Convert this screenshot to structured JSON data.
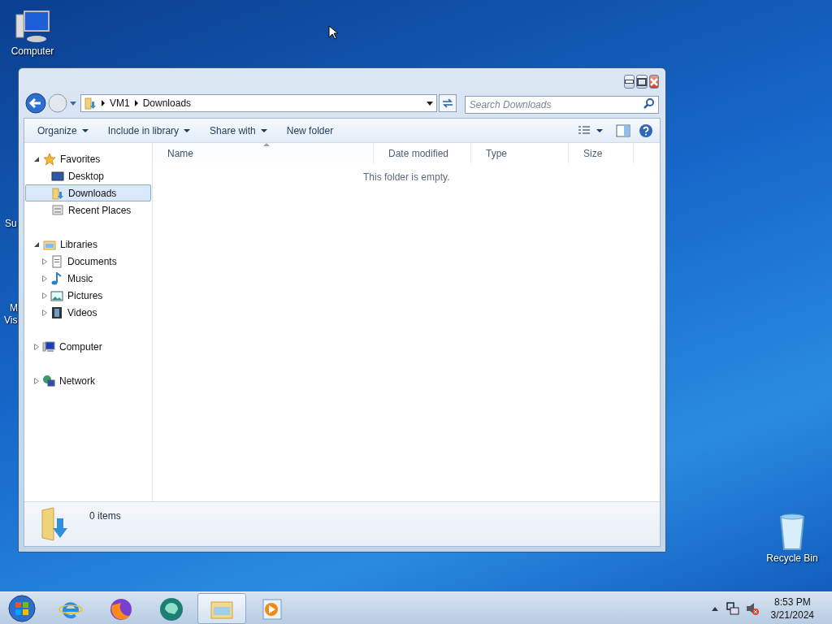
{
  "desktop": {
    "icons": [
      {
        "kind": "computer",
        "label": "Computer"
      },
      {
        "kind": "recycle",
        "label": "Recycle Bin"
      }
    ],
    "partial_labels": [
      "Su",
      "M",
      "Vis"
    ]
  },
  "window": {
    "address_bar": {
      "path": [
        "VM1",
        "Downloads"
      ]
    },
    "search": {
      "placeholder": "Search Downloads"
    },
    "toolbar": [
      {
        "label": "Organize",
        "dropdown": true
      },
      {
        "label": "Include in library",
        "dropdown": true
      },
      {
        "label": "Share with",
        "dropdown": true
      },
      {
        "label": "New folder",
        "dropdown": false
      }
    ],
    "navigation": [
      {
        "kind": "favorites",
        "label": "Favorites",
        "expanded": true,
        "selected": false,
        "children": [
          {
            "kind": "desktop",
            "label": "Desktop",
            "selected": false
          },
          {
            "kind": "downloads",
            "label": "Downloads",
            "selected": true
          },
          {
            "kind": "recent",
            "label": "Recent Places",
            "selected": false
          }
        ]
      },
      {
        "kind": "libraries",
        "label": "Libraries",
        "expanded": true,
        "selected": false,
        "children": [
          {
            "kind": "documents",
            "label": "Documents",
            "expanded": false,
            "selected": false
          },
          {
            "kind": "music",
            "label": "Music",
            "expanded": false,
            "selected": false
          },
          {
            "kind": "pictures",
            "label": "Pictures",
            "expanded": false,
            "selected": false
          },
          {
            "kind": "videos",
            "label": "Videos",
            "expanded": false,
            "selected": false
          }
        ]
      },
      {
        "kind": "computer",
        "label": "Computer",
        "expanded": false,
        "selected": false
      },
      {
        "kind": "network",
        "label": "Network",
        "expanded": false,
        "selected": false
      }
    ],
    "columns": [
      {
        "label": "Name",
        "sorted": true
      },
      {
        "label": "Date modified",
        "sorted": false
      },
      {
        "label": "Type",
        "sorted": false
      },
      {
        "label": "Size",
        "sorted": false
      }
    ],
    "empty_message": "This folder is empty.",
    "status": "0 items"
  },
  "taskbar": {
    "apps": [
      {
        "kind": "ie",
        "active": false
      },
      {
        "kind": "firefox",
        "active": false
      },
      {
        "kind": "teal",
        "active": false
      },
      {
        "kind": "explorer",
        "active": true
      },
      {
        "kind": "media",
        "active": false
      }
    ],
    "clock": {
      "time": "8:53 PM",
      "date": "3/21/2024"
    }
  }
}
